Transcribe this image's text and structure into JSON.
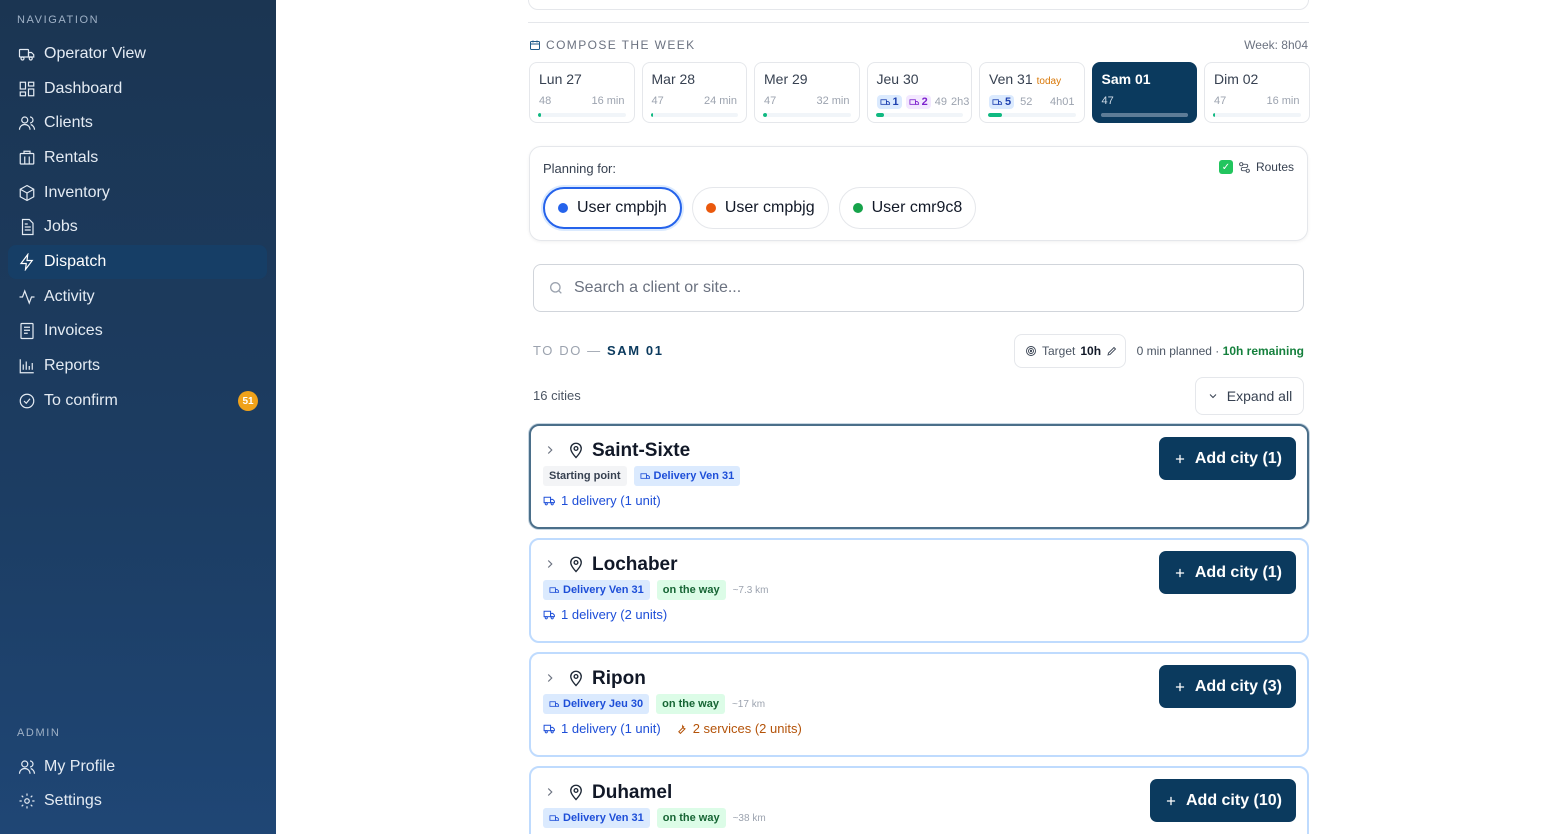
{
  "sidebar": {
    "nav_label": "NAVIGATION",
    "items": [
      {
        "label": "Operator View",
        "icon": "truck-icon"
      },
      {
        "label": "Dashboard",
        "icon": "grid-icon"
      },
      {
        "label": "Clients",
        "icon": "users-icon"
      },
      {
        "label": "Rentals",
        "icon": "building-icon"
      },
      {
        "label": "Inventory",
        "icon": "box-icon"
      },
      {
        "label": "Jobs",
        "icon": "file-icon"
      },
      {
        "label": "Dispatch",
        "icon": "bolt-icon",
        "active": true
      },
      {
        "label": "Activity",
        "icon": "activity-icon"
      },
      {
        "label": "Invoices",
        "icon": "receipt-icon"
      },
      {
        "label": "Reports",
        "icon": "bar-chart-icon"
      },
      {
        "label": "To confirm",
        "icon": "check-circle-icon",
        "badge": "51"
      }
    ],
    "admin_label": "ADMIN",
    "admin_items": [
      {
        "label": "My Profile",
        "icon": "users-icon"
      },
      {
        "label": "Settings",
        "icon": "gear-icon"
      }
    ]
  },
  "compose": {
    "title": "COMPOSE THE WEEK",
    "week_total": "Week: 8h04",
    "days": [
      {
        "name": "Lun 27",
        "count": "48",
        "duration": "16 min",
        "progress": 0.03
      },
      {
        "name": "Mar 28",
        "count": "47",
        "duration": "24 min",
        "progress": 0.03
      },
      {
        "name": "Mer 29",
        "count": "47",
        "duration": "32 min",
        "progress": 0.04
      },
      {
        "name": "Jeu 30",
        "chip1": "1",
        "chip2": "2",
        "count": "49",
        "duration": "2h3",
        "progress": 0.1
      },
      {
        "name": "Ven 31",
        "today": "today",
        "chip1": "5",
        "count": "52",
        "duration": "4h01",
        "progress": 0.16
      },
      {
        "name": "Sam 01",
        "count": "47",
        "duration": "",
        "progress": 1.0,
        "selected": true
      },
      {
        "name": "Dim 02",
        "count": "47",
        "duration": "16 min",
        "progress": 0.02
      }
    ]
  },
  "planning": {
    "label": "Planning for:",
    "routes_label": "Routes",
    "users": [
      {
        "name": "User cmpbjh",
        "color": "#2563eb",
        "selected": true
      },
      {
        "name": "User cmpbjg",
        "color": "#ea580c"
      },
      {
        "name": "User cmr9c8",
        "color": "#16a34a"
      }
    ]
  },
  "search": {
    "placeholder": "Search a client or site..."
  },
  "todo": {
    "prefix": "TO DO —",
    "day": "SAM 01",
    "target_label": "Target",
    "target_value": "10h",
    "planned": "0 min planned ·",
    "remaining": "10h remaining",
    "cities_count": "16 cities",
    "expand_label": "Expand all"
  },
  "cities": [
    {
      "name": "Saint-Sixte",
      "tag_start": "Starting point",
      "tag_delivery": "Delivery Ven 31",
      "tag_way": "",
      "km": "",
      "deliveries": "1 delivery (1 unit)",
      "services": "",
      "add_label": "Add city (1)"
    },
    {
      "name": "Lochaber",
      "tag_start": "",
      "tag_delivery": "Delivery Ven 31",
      "tag_way": "on the way",
      "km": "~7.3 km",
      "deliveries": "1 delivery (2 units)",
      "services": "",
      "add_label": "Add city (1)"
    },
    {
      "name": "Ripon",
      "tag_start": "",
      "tag_delivery": "Delivery Jeu 30",
      "tag_way": "on the way",
      "km": "~17 km",
      "deliveries": "1 delivery (1 unit)",
      "services": "2 services (2 units)",
      "add_label": "Add city (3)"
    },
    {
      "name": "Duhamel",
      "tag_start": "",
      "tag_delivery": "Delivery Ven 31",
      "tag_way": "on the way",
      "km": "~38 km",
      "deliveries": "",
      "services": "",
      "add_label": "Add city (10)"
    }
  ]
}
